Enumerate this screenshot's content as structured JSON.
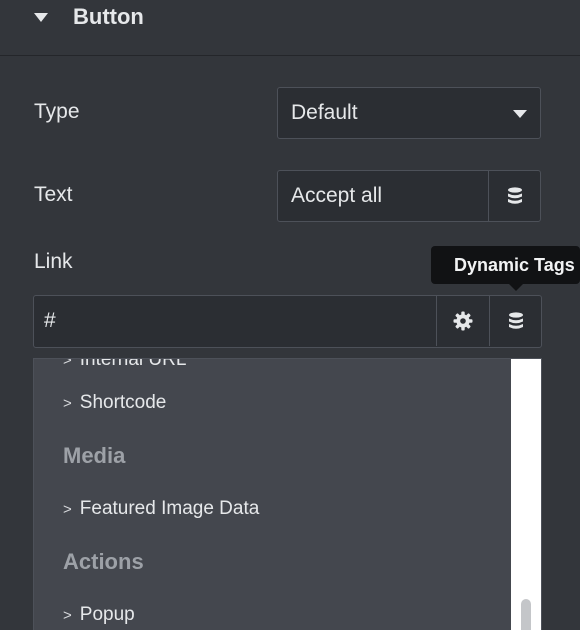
{
  "section": {
    "title": "Button"
  },
  "type_row": {
    "label": "Type",
    "value": "Default"
  },
  "text_row": {
    "label": "Text",
    "value": "Accept all"
  },
  "link_row": {
    "label": "Link",
    "value": "#"
  },
  "tooltip": {
    "text": "Dynamic Tags"
  },
  "dropdown": {
    "items": [
      {
        "kind": "item",
        "chevron": ">",
        "label": "Internal URL"
      },
      {
        "kind": "item",
        "chevron": ">",
        "label": "Shortcode"
      },
      {
        "kind": "group",
        "label": "Media"
      },
      {
        "kind": "item",
        "chevron": ">",
        "label": "Featured Image Data"
      },
      {
        "kind": "group",
        "label": "Actions"
      },
      {
        "kind": "item",
        "chevron": ">",
        "label": "Popup"
      }
    ]
  },
  "icons": {
    "section_toggle": "caret-down-icon",
    "select_arrow": "caret-down-icon",
    "dynamic_tags": "database-icon",
    "settings": "gear-icon"
  },
  "colors": {
    "panel_bg": "#33363b",
    "input_bg": "#2b2e33",
    "dropdown_bg": "#44474e",
    "tooltip_bg": "#111214",
    "group_label": "#9da1a7"
  }
}
